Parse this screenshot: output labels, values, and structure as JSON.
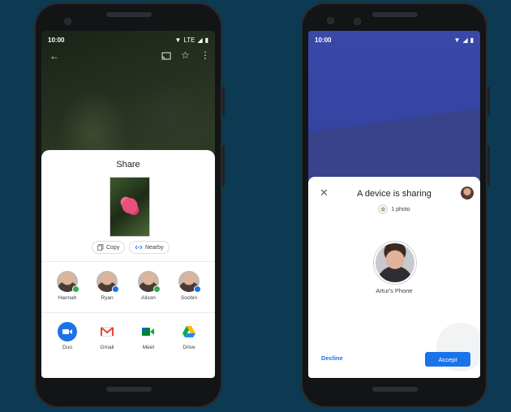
{
  "left_phone": {
    "status": {
      "time": "10:00",
      "network": "LTE"
    },
    "toolbar": {
      "back_icon": "arrow-left-icon",
      "cast_icon": "cast-icon",
      "star_icon": "star-icon",
      "more_icon": "more-vert-icon"
    },
    "share_sheet": {
      "title": "Share",
      "chips": [
        {
          "label": "Copy",
          "icon": "copy-icon"
        },
        {
          "label": "Nearby",
          "icon": "nearby-icon"
        }
      ],
      "contacts": [
        {
          "name": "Hannah",
          "badge_color": "#34a853"
        },
        {
          "name": "Ryan",
          "badge_color": "#1a73e8"
        },
        {
          "name": "Alison",
          "badge_color": "#34a853"
        },
        {
          "name": "Soobin",
          "badge_color": "#1a73e8"
        }
      ],
      "apps": [
        {
          "name": "Duo",
          "icon": "duo-icon"
        },
        {
          "name": "Gmail",
          "icon": "gmail-icon"
        },
        {
          "name": "Meet",
          "icon": "meet-icon"
        },
        {
          "name": "Drive",
          "icon": "drive-icon"
        }
      ]
    }
  },
  "right_phone": {
    "status": {
      "time": "10:00"
    },
    "dialog": {
      "title": "A device is sharing",
      "photo_count": "1 photo",
      "device_name": "Artur's Phone",
      "decline_label": "Decline",
      "accept_label": "Accept"
    }
  },
  "colors": {
    "background": "#0b3a52",
    "accent": "#1a73e8"
  }
}
